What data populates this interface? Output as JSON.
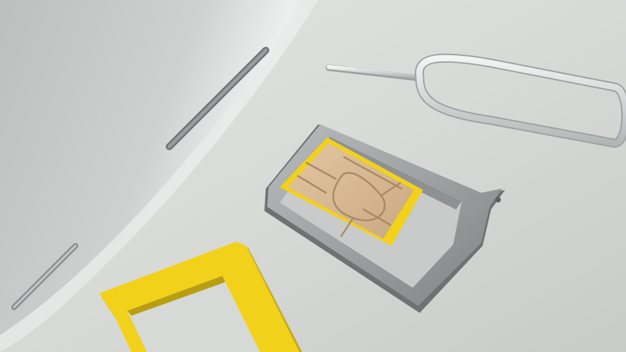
{
  "scene": {
    "objects": [
      "smartphone-edge",
      "sim-ejector-pin",
      "sim-card-tray",
      "nano-sim-card",
      "sim-adapter-frame"
    ],
    "colors": {
      "background": "#d9dbd8",
      "phone_body": "#c4c6c5",
      "phone_highlight": "#eceeed",
      "metal": "#a9acac",
      "metal_dark": "#7a7d7e",
      "sim_yellow": "#f2d11a",
      "chip_gold": "#d8b891",
      "chip_line": "#a88a66"
    }
  }
}
